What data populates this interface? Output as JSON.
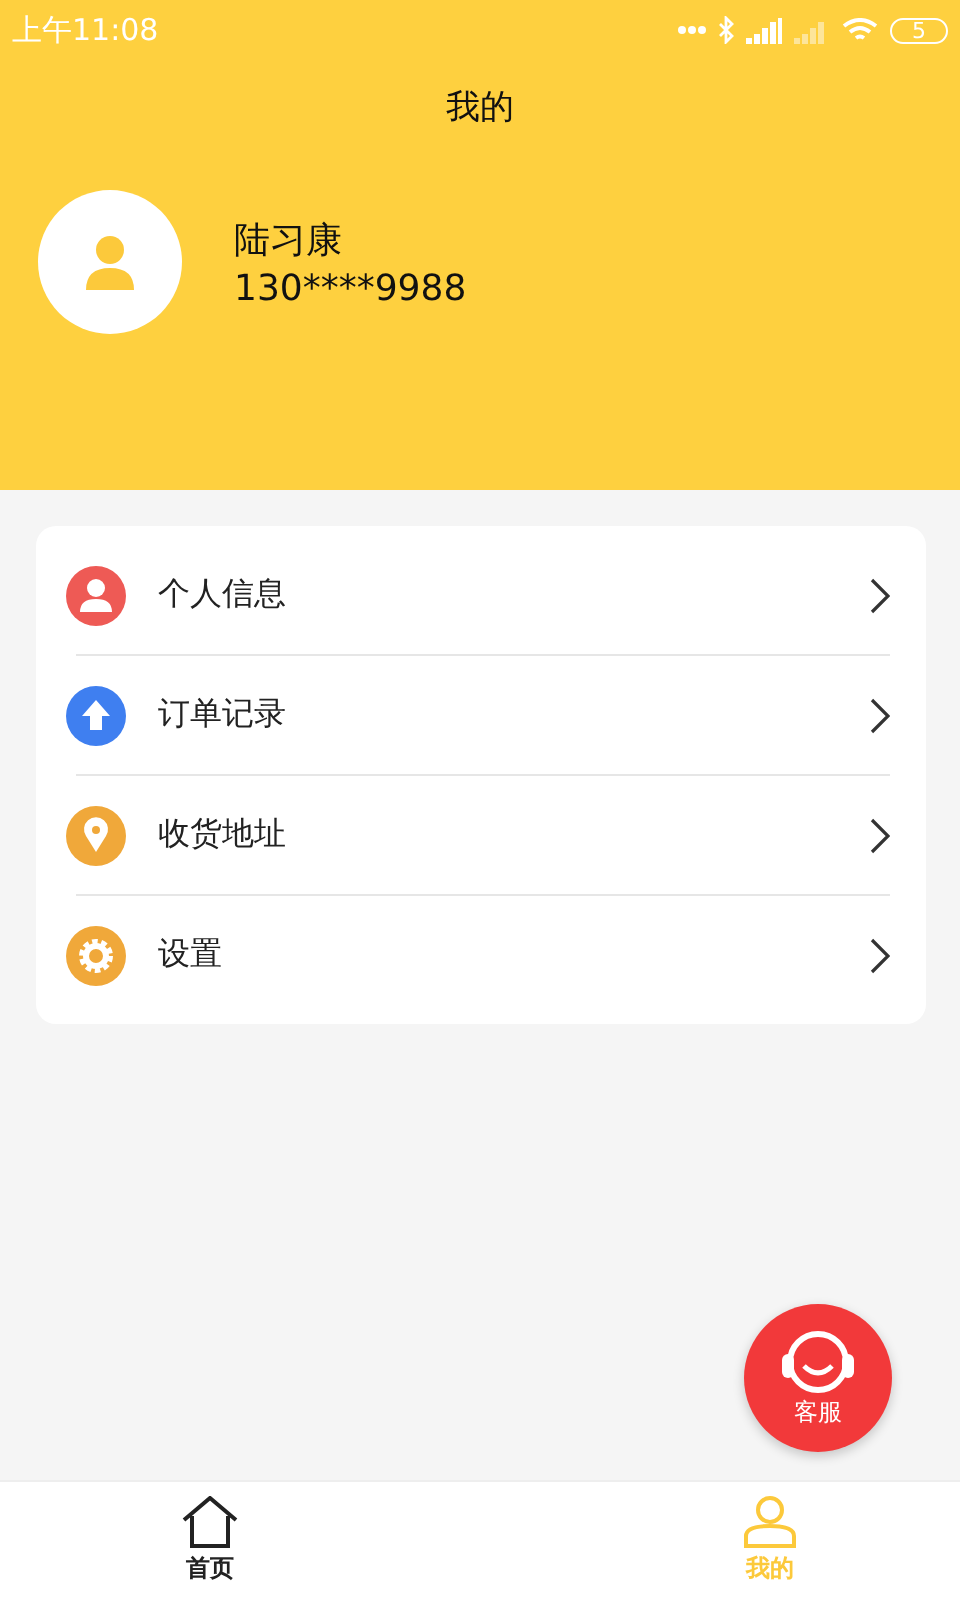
{
  "status_bar": {
    "time": "上午11:08",
    "battery": "5"
  },
  "header": {
    "title": "我的"
  },
  "profile": {
    "name": "陆习康",
    "phone": "130****9988"
  },
  "menu": [
    {
      "kind": "person",
      "label": "个人信息",
      "color": "#ee5a55"
    },
    {
      "kind": "upload",
      "label": "订单记录",
      "color": "#3f7ff0"
    },
    {
      "kind": "location",
      "label": "收货地址",
      "color": "#f0a83a"
    },
    {
      "kind": "settings",
      "label": "设置",
      "color": "#f0a83a"
    }
  ],
  "service_button": {
    "label": "客服"
  },
  "tabs": [
    {
      "kind": "home",
      "label": "首页",
      "selected": false
    },
    {
      "kind": "profile",
      "label": "我的",
      "selected": true
    }
  ]
}
